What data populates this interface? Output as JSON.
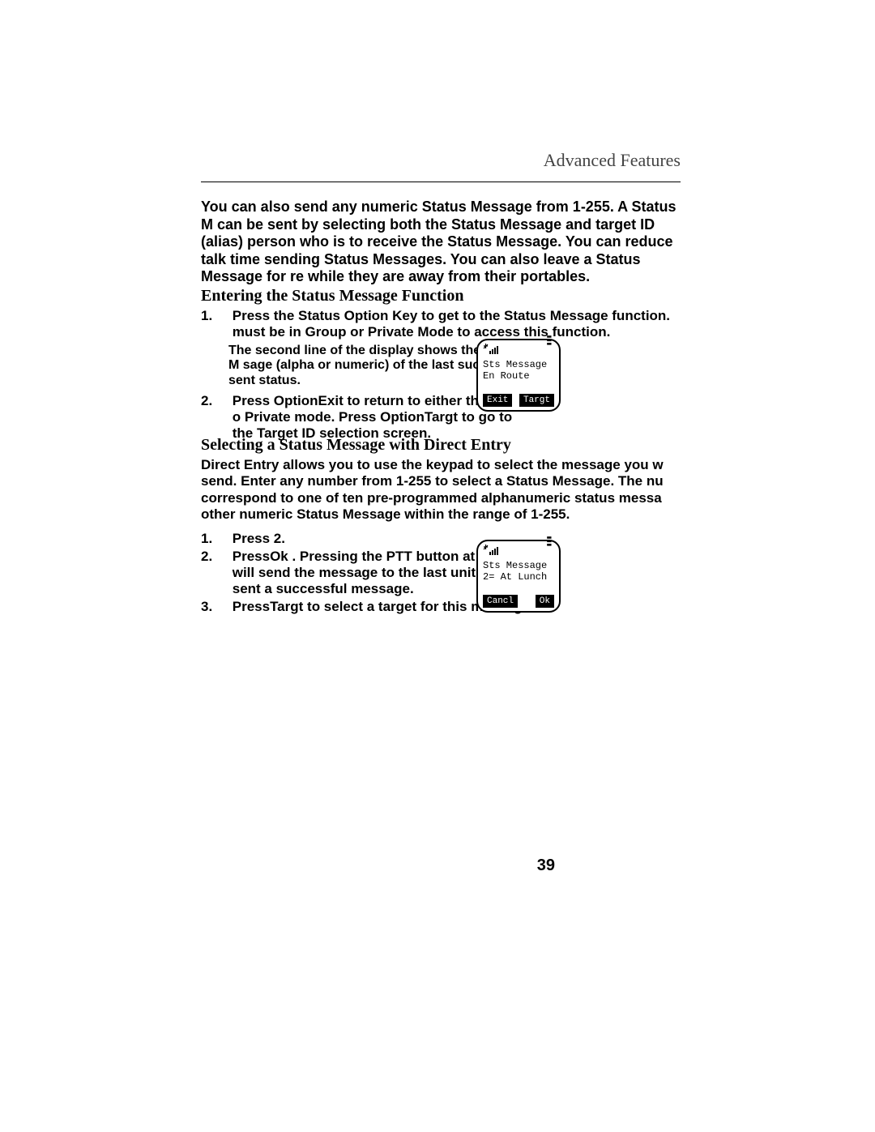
{
  "header": "Advanced Features",
  "intro": "You can also send any numeric Status Message from 1-255. A Status M can be sent by selecting both the Status Message and target ID (alias) person who is to receive the Status Message. You can reduce talk time sending Status Messages. You can also leave a Status Message for re while they are away from their portables.",
  "section1": {
    "title": "Entering the Status Message Function",
    "item1_num": "1.",
    "item1_text": "Press the Status Option Key to get to the Status Message function. must be in Group or Private Mode to access this function.",
    "item1_sub": "The second line of the display shows the Status M sage (alpha or numeric) of the last successfu sent status.",
    "item2_num": "2.",
    "item2_text_a": "Press Option",
    "item2_text_b": "Exit",
    "item2_text_c": " to return to either the group o Private mode. Press Option",
    "item2_text_d": "Targt",
    "item2_text_e": " to go to the Target ID selection screen."
  },
  "radio1": {
    "line1": "Sts Message",
    "line2": "En Route",
    "sk_left": "Exit",
    "sk_right": "Targt"
  },
  "section2": {
    "title": "Selecting a Status Message with Direct Entry",
    "intro": "Direct Entry allows you to use the keypad to select the message you w send. Enter any number from 1-255 to select a Status Message. The nu correspond to one of ten pre-programmed alphanumeric status messa other numeric Status Message within the range of 1-255.",
    "item1_num": "1.",
    "item1_text": "Press 2.",
    "item2_num": "2.",
    "item2_text_a": "Press",
    "item2_text_b": "Ok",
    "item2_text_c": " . Pressing the PTT button at this time will send the message to the last unit to which sent a successful message.",
    "item3_num": "3.",
    "item3_text_a": "Press",
    "item3_text_b": "Targt",
    "item3_text_c": " to select a target for this message."
  },
  "radio2": {
    "line1": "Sts Message",
    "line2": "2= At Lunch",
    "sk_left": "Cancl",
    "sk_right": "Ok"
  },
  "page_number": "39"
}
